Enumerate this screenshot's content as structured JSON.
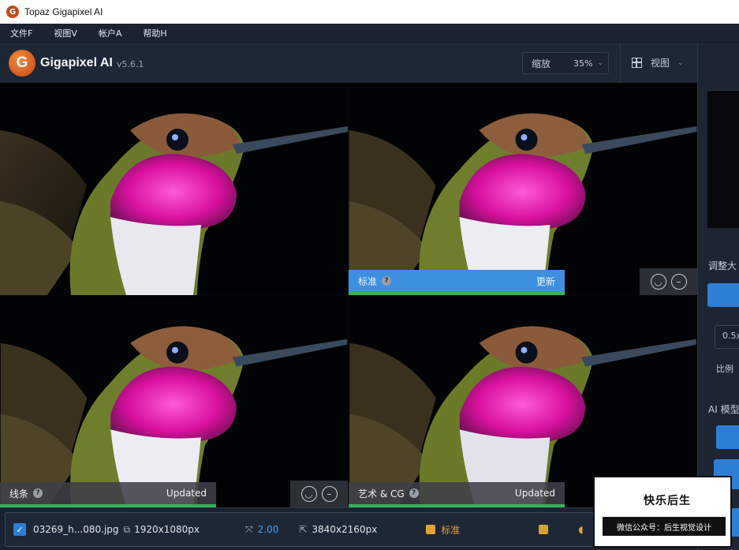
{
  "window": {
    "title": "Topaz Gigapixel AI",
    "icon": "G"
  },
  "menu": [
    {
      "label": "文件F"
    },
    {
      "label": "视图V"
    },
    {
      "label": "帐户A"
    },
    {
      "label": "帮助H"
    }
  ],
  "header": {
    "logo_letter": "G",
    "app_name": "Gigapixel AI",
    "version": "v5.6.1",
    "zoom_label": "缩放",
    "zoom_value": "35%",
    "view_label": "视图"
  },
  "panes": [
    {
      "id": "original",
      "selected": true
    },
    {
      "id": "standard",
      "model": "标准",
      "status": "更新",
      "active": true,
      "progress": 0.62,
      "feedback": true
    },
    {
      "id": "lines",
      "model": "线条",
      "status": "Updated",
      "active": false,
      "progress": 0.62,
      "feedback": true
    },
    {
      "id": "art",
      "model": "艺术 & CG",
      "status": "Updated",
      "active": false,
      "progress": 0.62,
      "feedback": true
    }
  ],
  "right_panel": {
    "resize_label": "调整大",
    "scale_input": "0.5x",
    "ratio_label": "比例",
    "ai_model_label": "AI 模型"
  },
  "file_row": {
    "checked": true,
    "filename": "03269_h...080.jpg",
    "input_size": "1920x1080px",
    "scale": "2.00",
    "output_size": "3840x2160px",
    "model": "标准"
  },
  "watermark": {
    "title": "快乐后生",
    "subtitle": "微信公众号：后生视觉设计"
  },
  "colors": {
    "accent_blue": "#3d8fe0",
    "progress_green": "#34b35a",
    "selection_cyan": "#4fc9e8",
    "model_orange": "#e0a33a"
  }
}
